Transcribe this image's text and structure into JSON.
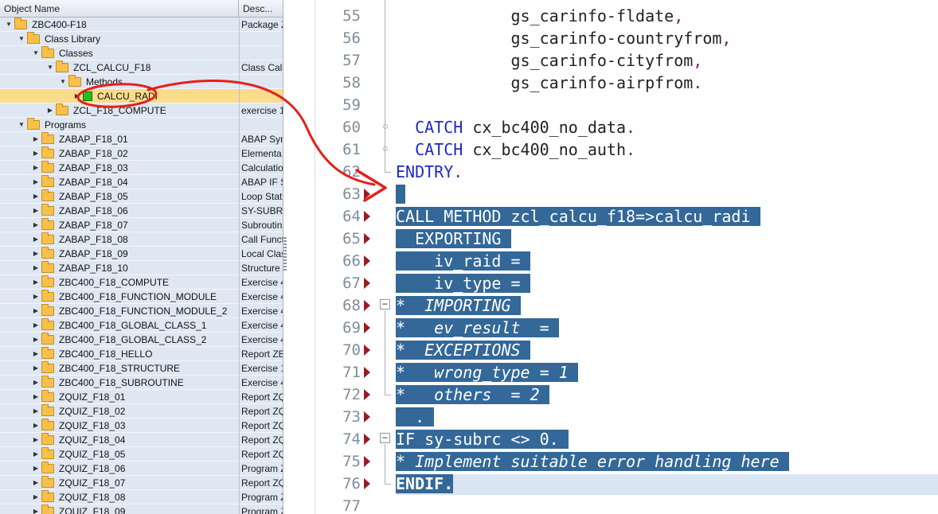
{
  "tree": {
    "header": {
      "name": "Object Name",
      "desc": "Desc..."
    },
    "rows": [
      {
        "label": "ZBC400-F18",
        "desc": "Package Z",
        "level": 0,
        "tri": "down",
        "icon": "folder"
      },
      {
        "label": "Class Library",
        "desc": "",
        "level": 1,
        "tri": "down",
        "icon": "folder"
      },
      {
        "label": "Classes",
        "desc": "",
        "level": 2,
        "tri": "down",
        "icon": "folder"
      },
      {
        "label": "ZCL_CALCU_F18",
        "desc": "Class Calcu",
        "level": 3,
        "tri": "down",
        "icon": "folder"
      },
      {
        "label": "Methods",
        "desc": "",
        "level": 4,
        "tri": "down",
        "icon": "folder"
      },
      {
        "label": "CALCU_RADI",
        "desc": "",
        "level": 5,
        "tri": "right",
        "icon": "method",
        "selected": true
      },
      {
        "label": "ZCL_F18_COMPUTE",
        "desc": "exercise 1",
        "level": 3,
        "tri": "right",
        "icon": "folder"
      },
      {
        "label": "Programs",
        "desc": "",
        "level": 1,
        "tri": "down",
        "icon": "folder"
      },
      {
        "label": "ZABAP_F18_01",
        "desc": "ABAP Syn",
        "level": 2,
        "tri": "right",
        "icon": "folder"
      },
      {
        "label": "ZABAP_F18_02",
        "desc": "Elementa",
        "level": 2,
        "tri": "right",
        "icon": "folder"
      },
      {
        "label": "ZABAP_F18_03",
        "desc": "Calculation",
        "level": 2,
        "tri": "right",
        "icon": "folder"
      },
      {
        "label": "ZABAP_F18_04",
        "desc": "ABAP IF S",
        "level": 2,
        "tri": "right",
        "icon": "folder"
      },
      {
        "label": "ZABAP_F18_05",
        "desc": "Loop Stat",
        "level": 2,
        "tri": "right",
        "icon": "folder"
      },
      {
        "label": "ZABAP_F18_06",
        "desc": "SY-SUBRC",
        "level": 2,
        "tri": "right",
        "icon": "folder"
      },
      {
        "label": "ZABAP_F18_07",
        "desc": "Subroutin",
        "level": 2,
        "tri": "right",
        "icon": "folder"
      },
      {
        "label": "ZABAP_F18_08",
        "desc": "Call Funct",
        "level": 2,
        "tri": "right",
        "icon": "folder"
      },
      {
        "label": "ZABAP_F18_09",
        "desc": "Local Clas",
        "level": 2,
        "tri": "right",
        "icon": "folder"
      },
      {
        "label": "ZABAP_F18_10",
        "desc": "Structure",
        "level": 2,
        "tri": "right",
        "icon": "folder"
      },
      {
        "label": "ZBC400_F18_COMPUTE",
        "desc": "Exercise 4",
        "level": 2,
        "tri": "right",
        "icon": "folder"
      },
      {
        "label": "ZBC400_F18_FUNCTION_MODULE",
        "desc": "Exercise 4",
        "level": 2,
        "tri": "right",
        "icon": "folder"
      },
      {
        "label": "ZBC400_F18_FUNCTION_MODULE_2",
        "desc": "Exercise 4",
        "level": 2,
        "tri": "right",
        "icon": "folder"
      },
      {
        "label": "ZBC400_F18_GLOBAL_CLASS_1",
        "desc": "Exercise 4",
        "level": 2,
        "tri": "right",
        "icon": "folder"
      },
      {
        "label": "ZBC400_F18_GLOBAL_CLASS_2",
        "desc": "Exercise 4",
        "level": 2,
        "tri": "right",
        "icon": "folder"
      },
      {
        "label": "ZBC400_F18_HELLO",
        "desc": "Report ZB",
        "level": 2,
        "tri": "right",
        "icon": "folder"
      },
      {
        "label": "ZBC400_F18_STRUCTURE",
        "desc": "Exercise 1",
        "level": 2,
        "tri": "right",
        "icon": "folder"
      },
      {
        "label": "ZBC400_F18_SUBROUTINE",
        "desc": "Exercise 4",
        "level": 2,
        "tri": "right",
        "icon": "folder"
      },
      {
        "label": "ZQUIZ_F18_01",
        "desc": "Report ZQ",
        "level": 2,
        "tri": "right",
        "icon": "folder"
      },
      {
        "label": "ZQUIZ_F18_02",
        "desc": "Report ZQ",
        "level": 2,
        "tri": "right",
        "icon": "folder"
      },
      {
        "label": "ZQUIZ_F18_03",
        "desc": "Report ZQ",
        "level": 2,
        "tri": "right",
        "icon": "folder"
      },
      {
        "label": "ZQUIZ_F18_04",
        "desc": "Report ZQ",
        "level": 2,
        "tri": "right",
        "icon": "folder"
      },
      {
        "label": "ZQUIZ_F18_05",
        "desc": "Report ZQ",
        "level": 2,
        "tri": "right",
        "icon": "folder"
      },
      {
        "label": "ZQUIZ_F18_06",
        "desc": "Program Z",
        "level": 2,
        "tri": "right",
        "icon": "folder"
      },
      {
        "label": "ZQUIZ_F18_07",
        "desc": "Report ZQ",
        "level": 2,
        "tri": "right",
        "icon": "folder"
      },
      {
        "label": "ZQUIZ_F18_08",
        "desc": "Program Z",
        "level": 2,
        "tri": "right",
        "icon": "folder"
      },
      {
        "label": "ZQUIZ_F18_09",
        "desc": "Program Z",
        "level": 2,
        "tri": "right",
        "icon": "folder"
      }
    ]
  },
  "editor": {
    "selection_color": "#336899",
    "lines": [
      {
        "num": "55",
        "segments": [
          {
            "t": "            gs_carinfo-fldate",
            "c": "op"
          },
          {
            "t": ",",
            "c": "pu"
          }
        ]
      },
      {
        "num": "56",
        "segments": [
          {
            "t": "            gs_carinfo-countryfrom",
            "c": "op"
          },
          {
            "t": ",",
            "c": "pu"
          }
        ]
      },
      {
        "num": "57",
        "segments": [
          {
            "t": "            gs_carinfo-cityfrom",
            "c": "op"
          },
          {
            "t": ",",
            "c": "pu"
          }
        ]
      },
      {
        "num": "58",
        "segments": [
          {
            "t": "            gs_carinfo-airpfrom",
            "c": "op"
          },
          {
            "t": ".",
            "c": "pu"
          }
        ]
      },
      {
        "num": "59",
        "segments": []
      },
      {
        "num": "60",
        "segments": [
          {
            "t": "  ",
            "c": "op"
          },
          {
            "t": "CATCH",
            "c": "kw"
          },
          {
            "t": " cx_bc400_no_data",
            "c": "op"
          },
          {
            "t": ".",
            "c": "pu"
          }
        ]
      },
      {
        "num": "61",
        "segments": [
          {
            "t": "  ",
            "c": "op"
          },
          {
            "t": "CATCH",
            "c": "kw"
          },
          {
            "t": " cx_bc400_no_auth",
            "c": "op"
          },
          {
            "t": ".",
            "c": "pu"
          }
        ]
      },
      {
        "num": "62",
        "segments": [
          {
            "t": "ENDTRY",
            "c": "kw"
          },
          {
            "t": ".",
            "c": "pu"
          }
        ]
      },
      {
        "num": "63",
        "selected": true,
        "text": " "
      },
      {
        "num": "64",
        "selected": true,
        "text": "CALL METHOD zcl_calcu_f18=>calcu_radi "
      },
      {
        "num": "65",
        "selected": true,
        "text": "  EXPORTING "
      },
      {
        "num": "66",
        "selected": true,
        "text": "    iv_raid = "
      },
      {
        "num": "67",
        "selected": true,
        "text": "    iv_type = "
      },
      {
        "num": "68",
        "selected": true,
        "comment": true,
        "text": "*  IMPORTING "
      },
      {
        "num": "69",
        "selected": true,
        "comment": true,
        "text": "*   ev_result  = "
      },
      {
        "num": "70",
        "selected": true,
        "comment": true,
        "text": "*  EXCEPTIONS "
      },
      {
        "num": "71",
        "selected": true,
        "comment": true,
        "text": "*   wrong_type = 1 "
      },
      {
        "num": "72",
        "selected": true,
        "comment": true,
        "text": "*   others  = 2 "
      },
      {
        "num": "73",
        "selected": true,
        "text": "  . "
      },
      {
        "num": "74",
        "selected": true,
        "text": "IF sy-subrc <> 0. "
      },
      {
        "num": "75",
        "selected": true,
        "comment": true,
        "text": "* Implement suitable error handling here "
      },
      {
        "num": "76",
        "selected": true,
        "bold": true,
        "text": "ENDIF."
      },
      {
        "num": "77",
        "segments": []
      }
    ]
  }
}
